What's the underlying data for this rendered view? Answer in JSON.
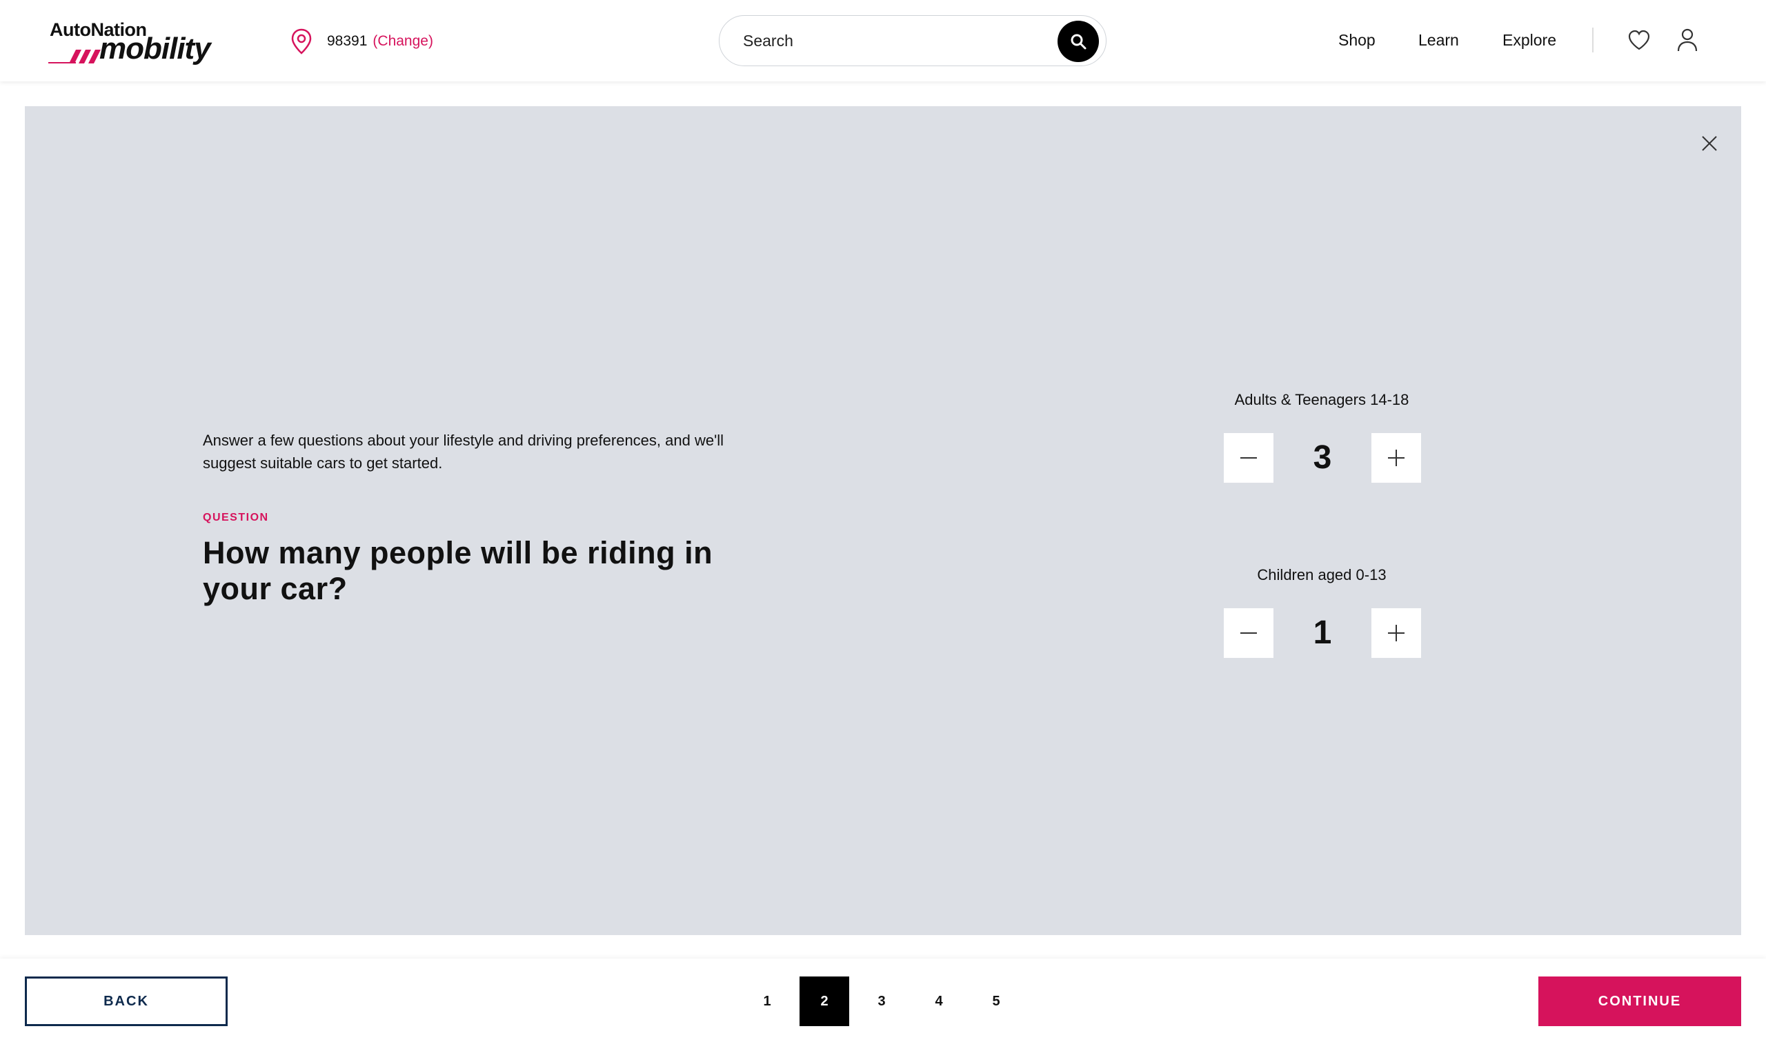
{
  "header": {
    "logo_top": "AutoNation",
    "logo_bottom": "mobility",
    "zip": "98391",
    "change_label": "(Change)",
    "search_placeholder": "Search",
    "nav": [
      "Shop",
      "Learn",
      "Explore"
    ]
  },
  "quiz": {
    "intro": "Answer a few questions about your lifestyle and driving preferences, and we'll suggest suitable cars to get started.",
    "question_label": "QUESTION",
    "question": "How many people will be riding in your car?",
    "counters": [
      {
        "label": "Adults & Teenagers 14-18",
        "value": "3"
      },
      {
        "label": "Children aged 0-13",
        "value": "1"
      }
    ]
  },
  "footer": {
    "back_label": "BACK",
    "continue_label": "CONTINUE",
    "steps": [
      "1",
      "2",
      "3",
      "4",
      "5"
    ],
    "active_step": "2"
  },
  "colors": {
    "accent": "#d6135c",
    "panel_bg": "#dcdfe5",
    "navy": "#0e2a4d"
  },
  "icons": [
    "location-pin-icon",
    "search-icon",
    "heart-icon",
    "user-icon",
    "close-icon",
    "minus-icon",
    "plus-icon"
  ]
}
